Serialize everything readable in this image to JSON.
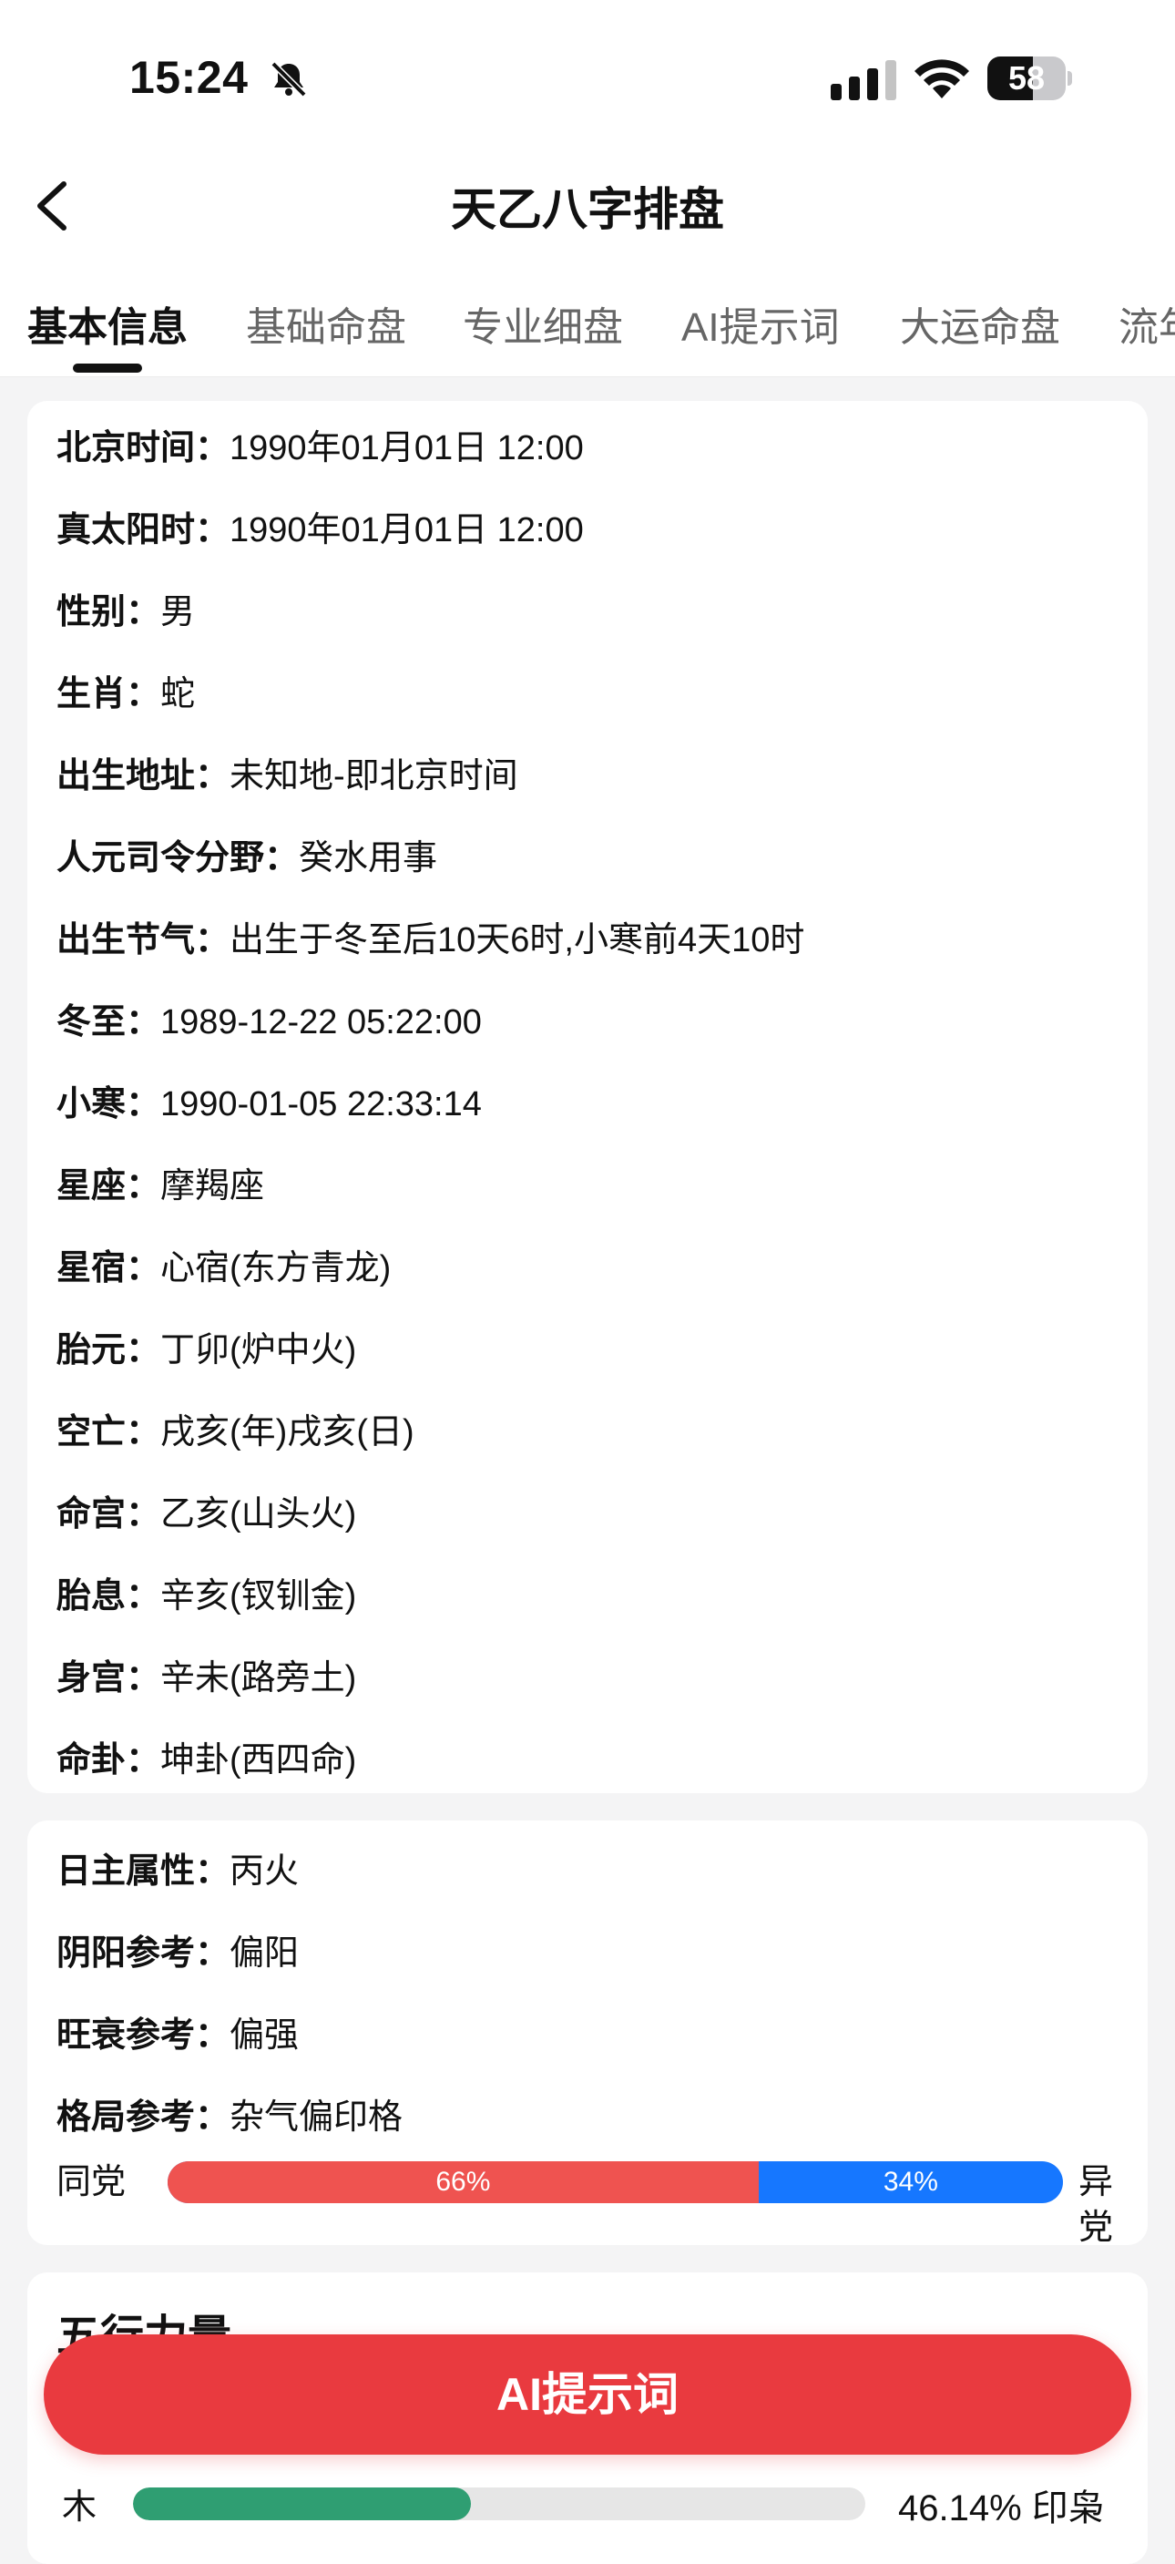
{
  "status_bar": {
    "time": "15:24",
    "battery": "58",
    "battery_level": 0.58
  },
  "nav": {
    "title": "天乙八字排盘"
  },
  "tabs": [
    {
      "label": "基本信息",
      "active": true
    },
    {
      "label": "基础命盘"
    },
    {
      "label": "专业细盘"
    },
    {
      "label": "AI提示词"
    },
    {
      "label": "大运命盘"
    },
    {
      "label": "流年"
    }
  ],
  "basic_info": [
    {
      "key": "北京时间：",
      "value": "1990年01月01日 12:00"
    },
    {
      "key": "真太阳时：",
      "value": "1990年01月01日 12:00"
    },
    {
      "key": "性别：",
      "value": "男"
    },
    {
      "key": "生肖：",
      "value": "蛇"
    },
    {
      "key": "出生地址：",
      "value": "未知地-即北京时间"
    },
    {
      "key": "人元司令分野：",
      "value": "癸水用事"
    },
    {
      "key": "出生节气：",
      "value": "出生于冬至后10天6时,小寒前4天10时"
    },
    {
      "key": "冬至：",
      "value": "1989-12-22 05:22:00"
    },
    {
      "key": "小寒：",
      "value": "1990-01-05 22:33:14"
    },
    {
      "key": "星座：",
      "value": "摩羯座"
    },
    {
      "key": "星宿：",
      "value": "心宿(东方青龙)"
    },
    {
      "key": "胎元：",
      "value": "丁卯(炉中火)"
    },
    {
      "key": "空亡：",
      "value": "戌亥(年)戌亥(日)"
    },
    {
      "key": "命宫：",
      "value": "乙亥(山头火)"
    },
    {
      "key": "胎息：",
      "value": "辛亥(钗钏金)"
    },
    {
      "key": "身宫：",
      "value": "辛未(路旁土)"
    },
    {
      "key": "命卦：",
      "value": "坤卦(西四命)"
    }
  ],
  "day_master": [
    {
      "key": "日主属性：",
      "value": "丙火"
    },
    {
      "key": "阴阳参考：",
      "value": "偏阳"
    },
    {
      "key": "旺衰参考：",
      "value": "偏强"
    },
    {
      "key": "格局参考：",
      "value": "杂气偏印格"
    }
  ],
  "party": {
    "left_label": "同党",
    "right_label": "异党",
    "same_pct": "66%",
    "other_pct": "34%",
    "same_ratio": 0.66,
    "same_color": "#ef5350",
    "other_color": "#1677ff"
  },
  "wuxing": {
    "title": "五行力量",
    "rows": [
      {
        "name": "木",
        "value": "46.14% 印枭",
        "ratio": 0.4614,
        "color": "#2f9e72"
      }
    ]
  },
  "ai_button": {
    "label": "AI提示词"
  }
}
